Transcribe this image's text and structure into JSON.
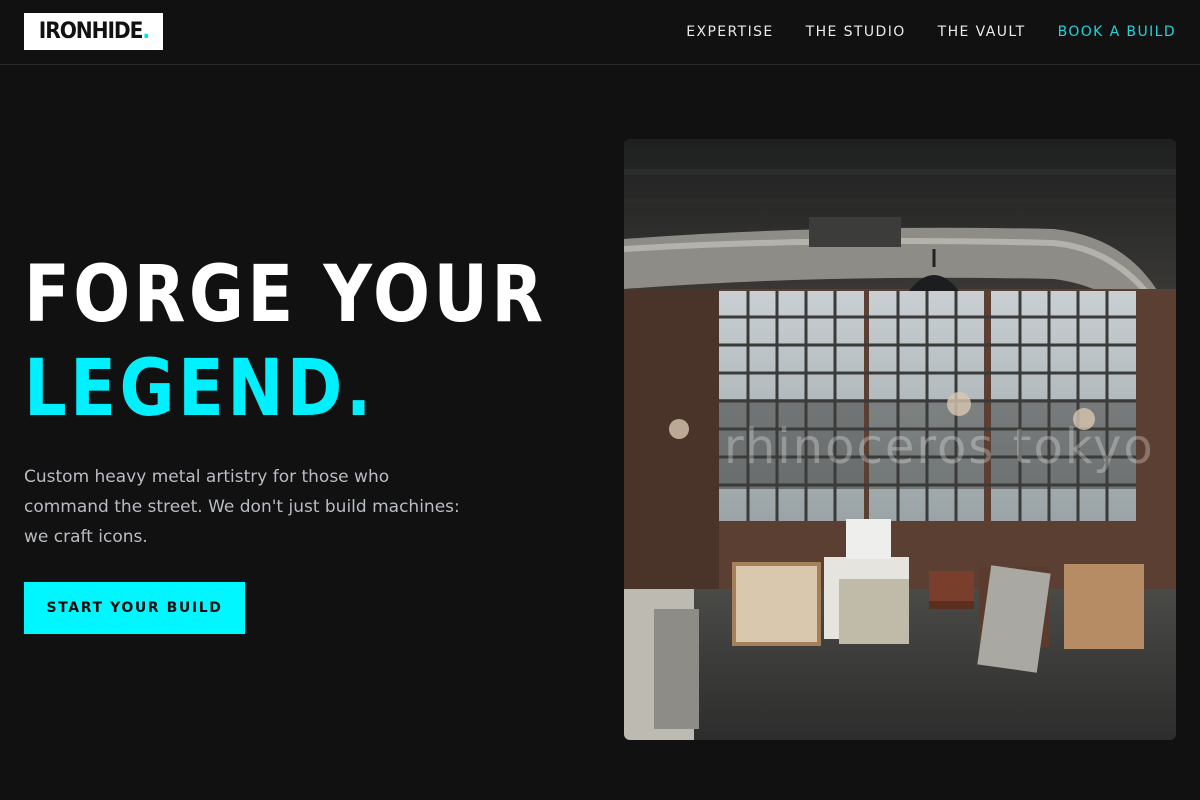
{
  "brand": {
    "name": "IRONHIDE",
    "dot": ".",
    "accent_color": "#00f0ff"
  },
  "nav": {
    "items": [
      {
        "label": "EXPERTISE"
      },
      {
        "label": "THE STUDIO"
      },
      {
        "label": "THE VAULT"
      },
      {
        "label": "BOOK A BUILD"
      }
    ]
  },
  "hero": {
    "title_line1": "FORGE YOUR",
    "title_line2": "LEGEND.",
    "subtitle": "Custom heavy metal artistry for those who command the street. We don't just build machines: we craft icons.",
    "cta_label": "START YOUR BUILD",
    "image": {
      "watermark": "rhinoceros tokyo",
      "icon": "workshop-studio-photo"
    }
  },
  "colors": {
    "background": "#111111",
    "accent": "#00f0ff",
    "text": "#ffffff",
    "muted_text": "#b9bcc3"
  }
}
